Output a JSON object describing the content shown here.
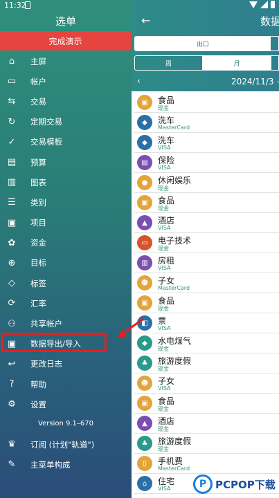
{
  "status": {
    "time": "11:32"
  },
  "header": {
    "back_icon": "←",
    "title": "数据"
  },
  "tabs_type": {
    "export": "出口"
  },
  "tabs_period": {
    "week": "周",
    "month": "月"
  },
  "range": {
    "prev": "‹",
    "text": "2024/11/3 –"
  },
  "transactions": [
    {
      "name": "食品",
      "account": "现金",
      "color": "#e3a53b",
      "icon": "▣"
    },
    {
      "name": "洗车",
      "account": "MasterCard",
      "color": "#2b6fa8",
      "icon": "◆"
    },
    {
      "name": "洗车",
      "account": "VISA",
      "color": "#2b6fa8",
      "icon": "◆"
    },
    {
      "name": "保险",
      "account": "VISA",
      "color": "#7a4fb0",
      "icon": "▤"
    },
    {
      "name": "休闲娱乐",
      "account": "现金",
      "color": "#e3a53b",
      "icon": "●"
    },
    {
      "name": "食品",
      "account": "现金",
      "color": "#e3a53b",
      "icon": "▣"
    },
    {
      "name": "酒店",
      "account": "VISA",
      "color": "#7a4fb0",
      "icon": "▲"
    },
    {
      "name": "电子技术",
      "account": "现金",
      "color": "#d6542a",
      "icon": "▭"
    },
    {
      "name": "房租",
      "account": "VISA",
      "color": "#7a4fb0",
      "icon": "▥"
    },
    {
      "name": "子女",
      "account": "MasterCard",
      "color": "#e3a53b",
      "icon": "☻"
    },
    {
      "name": "食品",
      "account": "现金",
      "color": "#e3a53b",
      "icon": "▣"
    },
    {
      "name": "票",
      "account": "VISA",
      "color": "#2b6fa8",
      "icon": "◧"
    },
    {
      "name": "水电煤气",
      "account": "现金",
      "color": "#2a9a8a",
      "icon": "◆"
    },
    {
      "name": "旅游度假",
      "account": "现金",
      "color": "#2a9a8a",
      "icon": "♣"
    },
    {
      "name": "子女",
      "account": "VISA",
      "color": "#e3a53b",
      "icon": "☻"
    },
    {
      "name": "食品",
      "account": "现金",
      "color": "#e3a53b",
      "icon": "▣"
    },
    {
      "name": "酒店",
      "account": "现金",
      "color": "#7a4fb0",
      "icon": "▲"
    },
    {
      "name": "旅游度假",
      "account": "现金",
      "color": "#2a9a8a",
      "icon": "♣"
    },
    {
      "name": "手机费",
      "account": "MasterCard",
      "color": "#e3a53b",
      "icon": "▯"
    },
    {
      "name": "住宅",
      "account": "VISA",
      "color": "#2b6fa8",
      "icon": "⌂"
    }
  ],
  "drawer": {
    "title": "选单",
    "demo_button": "完成演示",
    "items": [
      {
        "label": "主屏",
        "icon": "⌂",
        "name": "home"
      },
      {
        "label": "帐户",
        "icon": "▭",
        "name": "accounts"
      },
      {
        "label": "交易",
        "icon": "⇆",
        "name": "transactions"
      },
      {
        "label": "定期交易",
        "icon": "↻",
        "name": "scheduled-transactions"
      },
      {
        "label": "交易模板",
        "icon": "✓",
        "name": "transaction-templates"
      },
      {
        "label": "预算",
        "icon": "▤",
        "name": "budget"
      },
      {
        "label": "图表",
        "icon": "▥",
        "name": "charts"
      },
      {
        "label": "类别",
        "icon": "☰",
        "name": "categories"
      },
      {
        "label": "项目",
        "icon": "▣",
        "name": "projects"
      },
      {
        "label": "资金",
        "icon": "✿",
        "name": "funds"
      },
      {
        "label": "目标",
        "icon": "⊕",
        "name": "goals"
      },
      {
        "label": "标签",
        "icon": "◇",
        "name": "tags"
      },
      {
        "label": "汇率",
        "icon": "⟳",
        "name": "exchange-rates"
      },
      {
        "label": "共享帐户",
        "icon": "⚇",
        "name": "shared-accounts"
      },
      {
        "label": "数据导出/导入",
        "icon": "▣",
        "name": "data-export-import"
      },
      {
        "label": "更改日志",
        "icon": "↩",
        "name": "changelog"
      },
      {
        "label": "帮助",
        "icon": "?",
        "name": "help"
      },
      {
        "label": "设置",
        "icon": "⚙",
        "name": "settings"
      }
    ],
    "version": "Version 9.1–670",
    "bottom_items": [
      {
        "label": "订阅 (计划\"轨道\")",
        "icon": "♛",
        "name": "subscription"
      },
      {
        "label": "主菜单构成",
        "icon": "✎",
        "name": "main-menu-layout"
      }
    ]
  },
  "watermark": {
    "logo": "P",
    "brand": "PCPOP下载"
  }
}
